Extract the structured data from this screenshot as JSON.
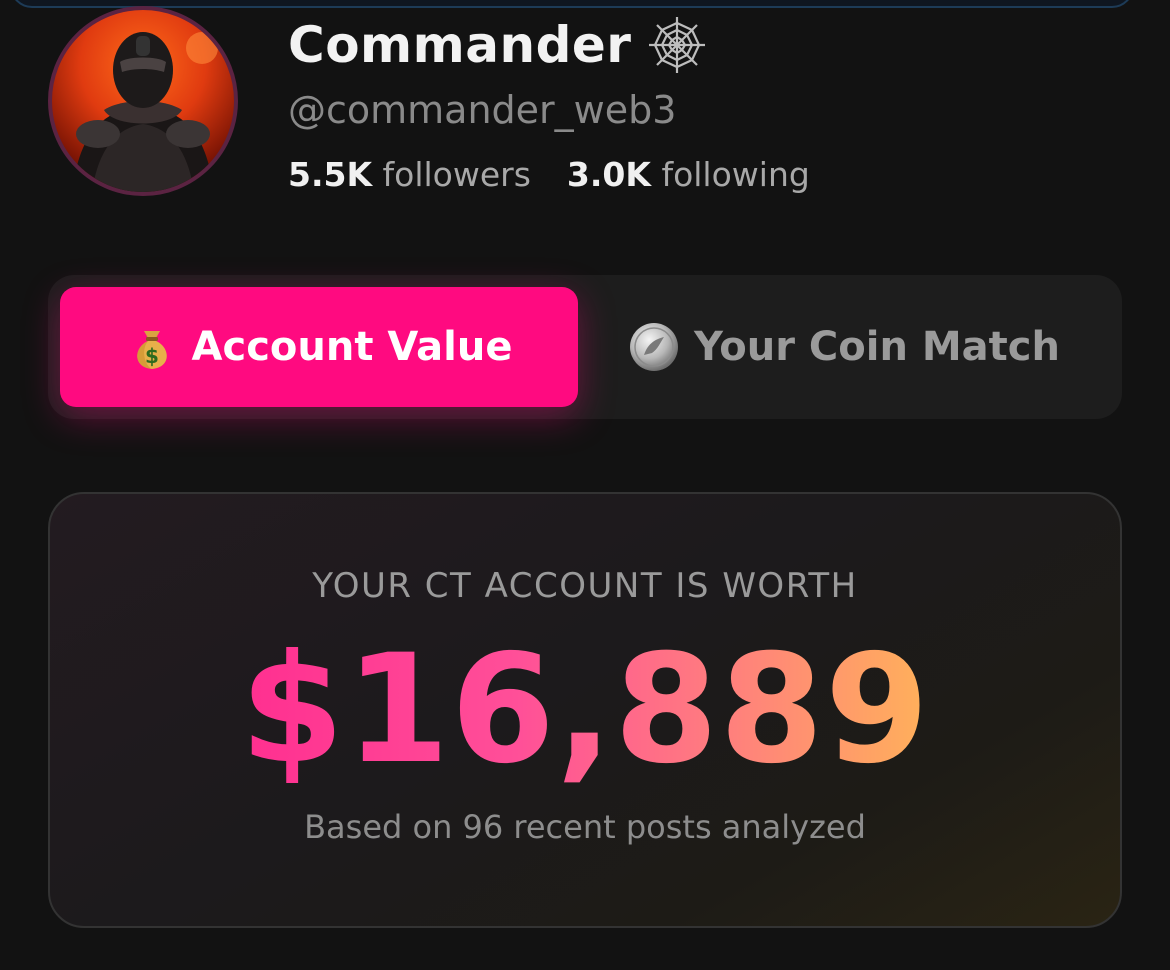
{
  "profile": {
    "name": "Commander",
    "badge_icon": "spider-web-icon",
    "handle": "@commander_web3",
    "followers_count": "5.5K",
    "followers_label": "followers",
    "following_count": "3.0K",
    "following_label": "following"
  },
  "tabs": [
    {
      "label": "Account Value",
      "icon": "money-bag-icon",
      "active": true
    },
    {
      "label": "Your Coin Match",
      "icon": "silver-coin-icon",
      "active": false
    }
  ],
  "card": {
    "label": "YOUR CT ACCOUNT IS WORTH",
    "value": "$16,889",
    "subtext": "Based on 96 recent posts analyzed"
  },
  "colors": {
    "accent": "#ff0a80",
    "background": "#121212",
    "value_gradient_start": "#ff2f90",
    "value_gradient_end": "#ffb15a"
  }
}
